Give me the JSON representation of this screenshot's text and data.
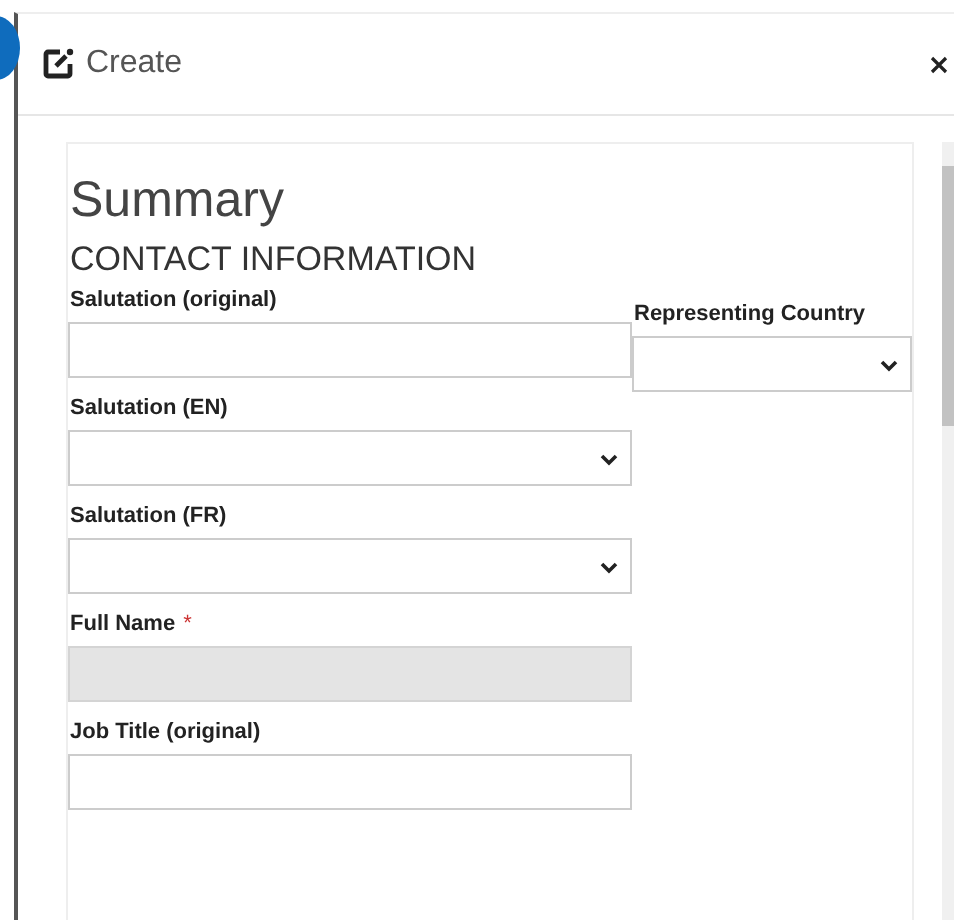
{
  "dialog": {
    "title": "Create"
  },
  "form": {
    "heading": "Summary",
    "section": "CONTACT INFORMATION",
    "main_fields": [
      {
        "label": "Salutation (original)",
        "kind": "text",
        "disabled": false
      },
      {
        "label": "Salutation (EN)",
        "kind": "select",
        "disabled": false
      },
      {
        "label": "Salutation (FR)",
        "kind": "select",
        "disabled": false
      },
      {
        "label": "Full Name",
        "required_mark": "*",
        "kind": "text",
        "disabled": true
      },
      {
        "label": "Job Title (original)",
        "kind": "text",
        "disabled": false
      }
    ],
    "side_fields": [
      {
        "label": "Representing Country",
        "kind": "select",
        "disabled": false
      }
    ]
  }
}
